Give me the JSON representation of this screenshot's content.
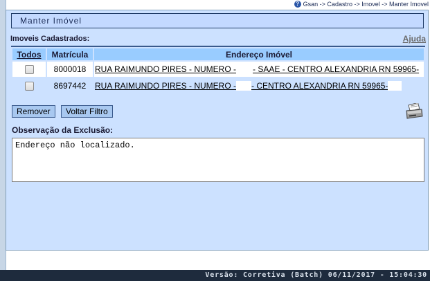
{
  "breadcrumb": "Gsan -> Cadastro -> Imovel -> Manter Imovel",
  "panel_title": "Manter Imóvel",
  "section_label": "Imoveis Cadastrados:",
  "help_label": "Ajuda",
  "table": {
    "headers": {
      "todos": "Todos",
      "matricula": "Matrícula",
      "endereco": "Endereço Imóvel"
    },
    "rows": [
      {
        "matricula": "8000018",
        "endereco_a": "RUA RAIMUNDO PIRES - NUMERO -",
        "endereco_b": "- SAAE - CENTRO ALEXANDRIA RN 59965-",
        "checked": false
      },
      {
        "matricula": "8697442",
        "endereco_a": "RUA RAIMUNDO PIRES - NUMERO -",
        "endereco_b": "- CENTRO ALEXANDRIA RN 59965-",
        "checked": false
      }
    ]
  },
  "buttons": {
    "remover": "Remover",
    "voltar": "Voltar Filtro"
  },
  "observacao": {
    "label": "Observação da Exclusão:",
    "value": "Endereço não localizado."
  },
  "footer": "Versão: Corretiva (Batch) 06/11/2017 - 15:04:30",
  "colors": {
    "panel_bg": "#cce1ff",
    "header_bg": "#99ccff",
    "footer_bg": "#1e2b3d"
  },
  "icons": [
    "help-icon",
    "printer-icon"
  ]
}
